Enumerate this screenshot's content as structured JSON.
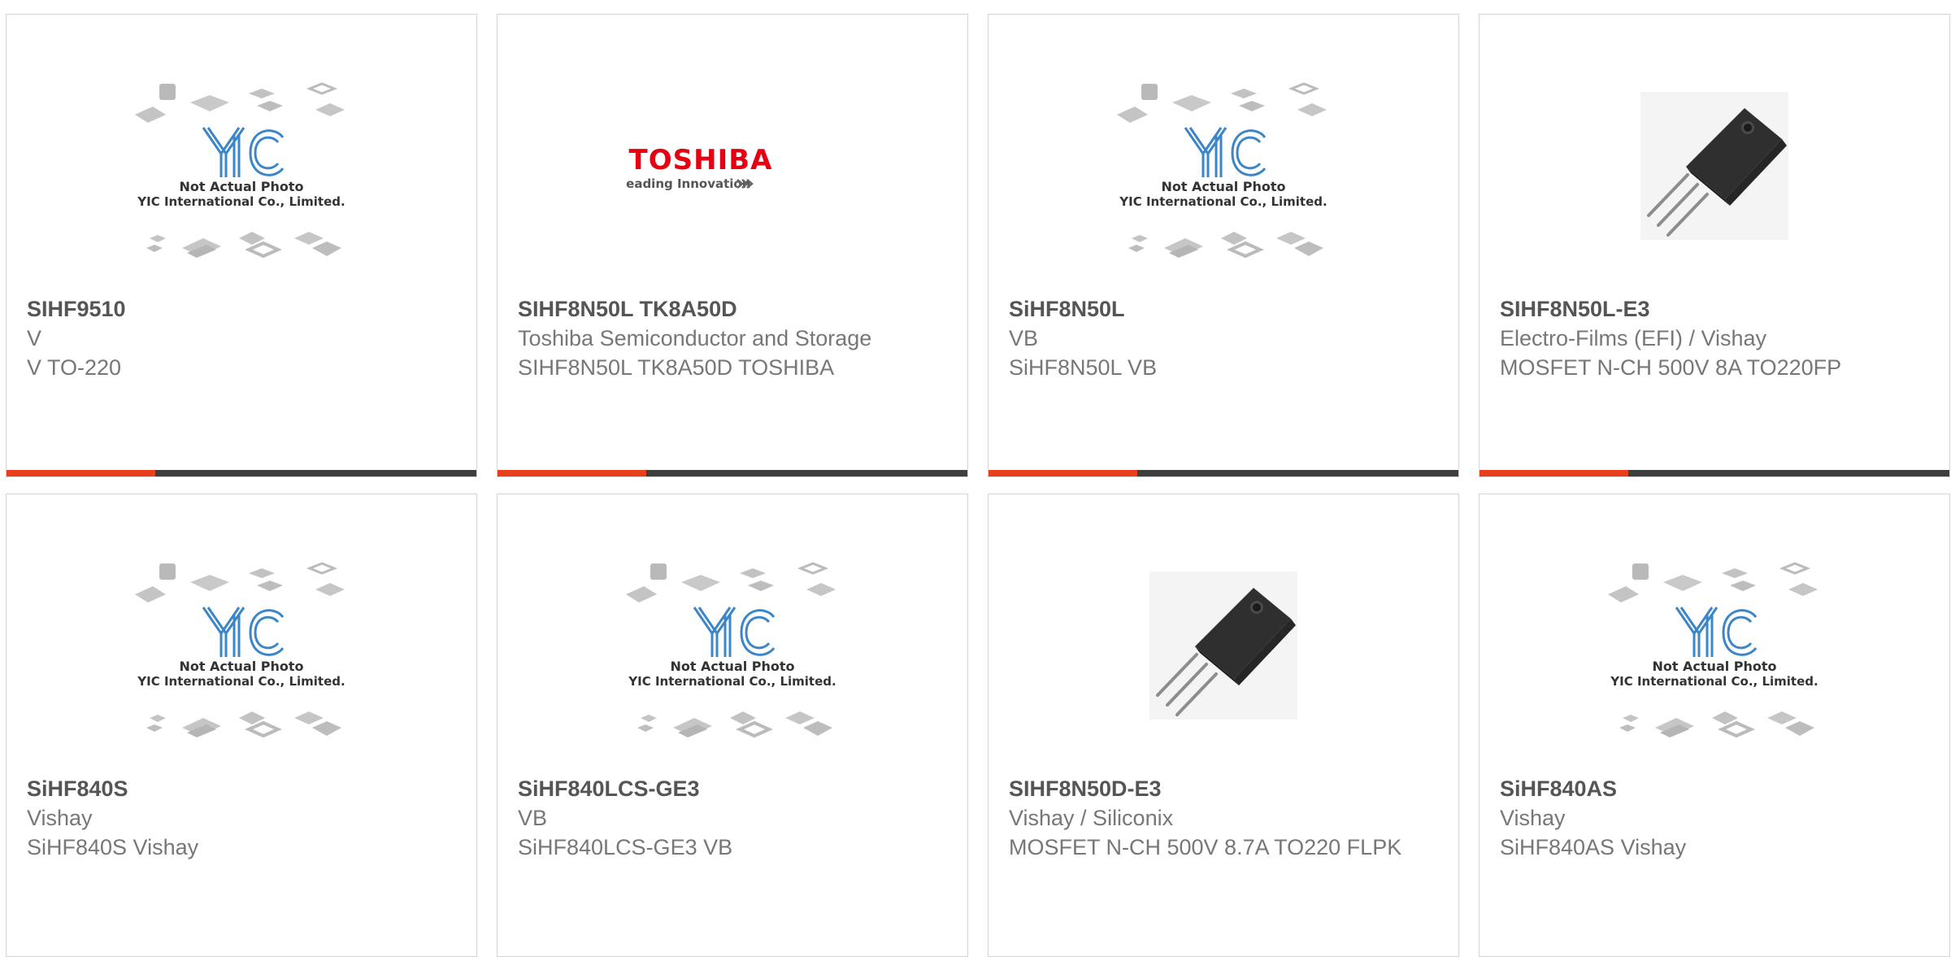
{
  "colors": {
    "accent": "#e8401c",
    "bar_dark": "#3e3e3e",
    "yic_blue": "#3a86c8",
    "toshiba_red": "#e60012"
  },
  "products": [
    {
      "part_number": "SIHF9510",
      "manufacturer": "V",
      "description": "V TO-220",
      "image": "yic-placeholder",
      "image_text": [
        "Not Actual Photo",
        "YIC International Co., Limited."
      ]
    },
    {
      "part_number": "SIHF8N50L TK8A50D",
      "manufacturer": "Toshiba Semiconductor and Storage",
      "description": "SIHF8N50L TK8A50D TOSHIBA",
      "image": "toshiba-logo",
      "image_text": [
        "TOSHIBA",
        "Leading Innovation"
      ]
    },
    {
      "part_number": "SiHF8N50L",
      "manufacturer": "VB",
      "description": "SiHF8N50L VB",
      "image": "yic-placeholder",
      "image_text": [
        "Not Actual Photo",
        "YIC International Co., Limited."
      ]
    },
    {
      "part_number": "SIHF8N50L-E3",
      "manufacturer": "Electro-Films (EFI) / Vishay",
      "description": "MOSFET N-CH 500V 8A TO220FP",
      "image": "to220-photo"
    },
    {
      "part_number": "SiHF840S",
      "manufacturer": "Vishay",
      "description": "SiHF840S Vishay",
      "image": "yic-placeholder",
      "image_text": [
        "Not Actual Photo",
        "YIC International Co., Limited."
      ]
    },
    {
      "part_number": "SiHF840LCS-GE3",
      "manufacturer": "VB",
      "description": "SiHF840LCS-GE3 VB",
      "image": "yic-placeholder",
      "image_text": [
        "Not Actual Photo",
        "YIC International Co., Limited."
      ]
    },
    {
      "part_number": "SIHF8N50D-E3",
      "manufacturer": "Vishay / Siliconix",
      "description": "MOSFET N-CH 500V 8.7A TO220 FLPK",
      "image": "to220-photo"
    },
    {
      "part_number": "SiHF840AS",
      "manufacturer": "Vishay",
      "description": "SiHF840AS Vishay",
      "image": "yic-placeholder",
      "image_text": [
        "Not Actual Photo",
        "YIC International Co., Limited."
      ]
    }
  ]
}
